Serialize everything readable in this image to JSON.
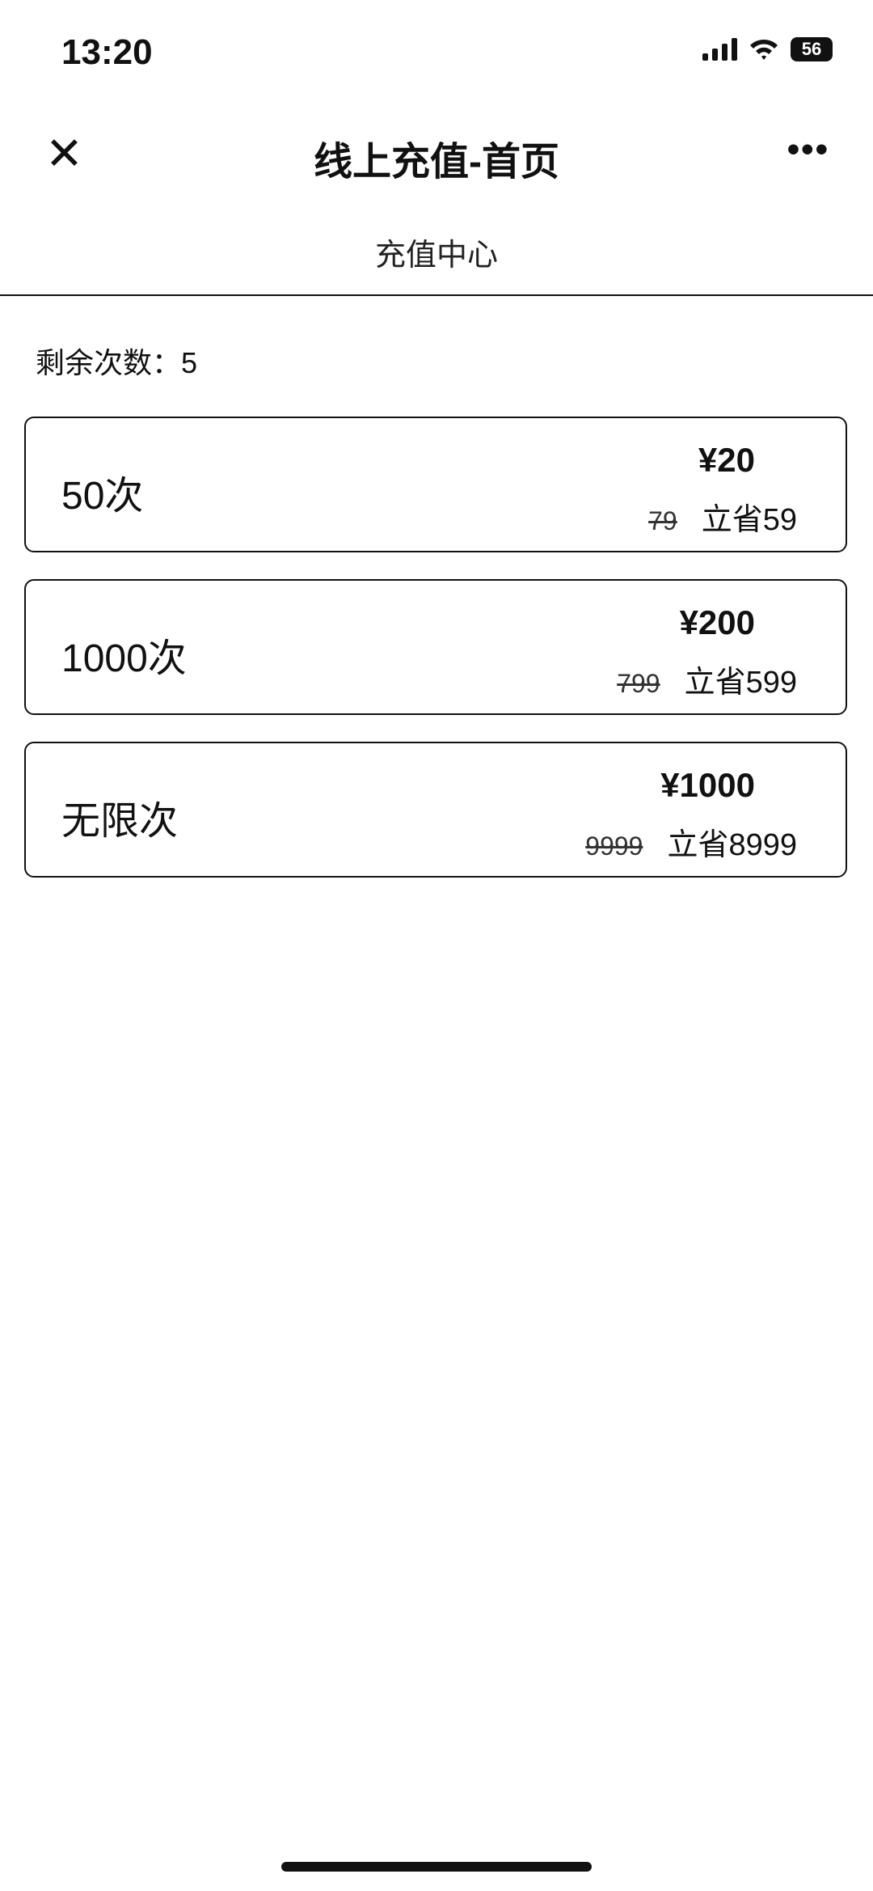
{
  "status_bar": {
    "time": "13:20",
    "battery": "56"
  },
  "nav": {
    "title": "线上充值-首页"
  },
  "tab": {
    "label": "充值中心"
  },
  "remaining": {
    "label": "剩余次数：",
    "value": "5"
  },
  "packages": [
    {
      "name": "50次",
      "price": "¥20",
      "original": "79",
      "save": "立省59"
    },
    {
      "name": "1000次",
      "price": "¥200",
      "original": "799",
      "save": "立省599"
    },
    {
      "name": "无限次",
      "price": "¥1000",
      "original": "9999",
      "save": "立省8999"
    }
  ]
}
